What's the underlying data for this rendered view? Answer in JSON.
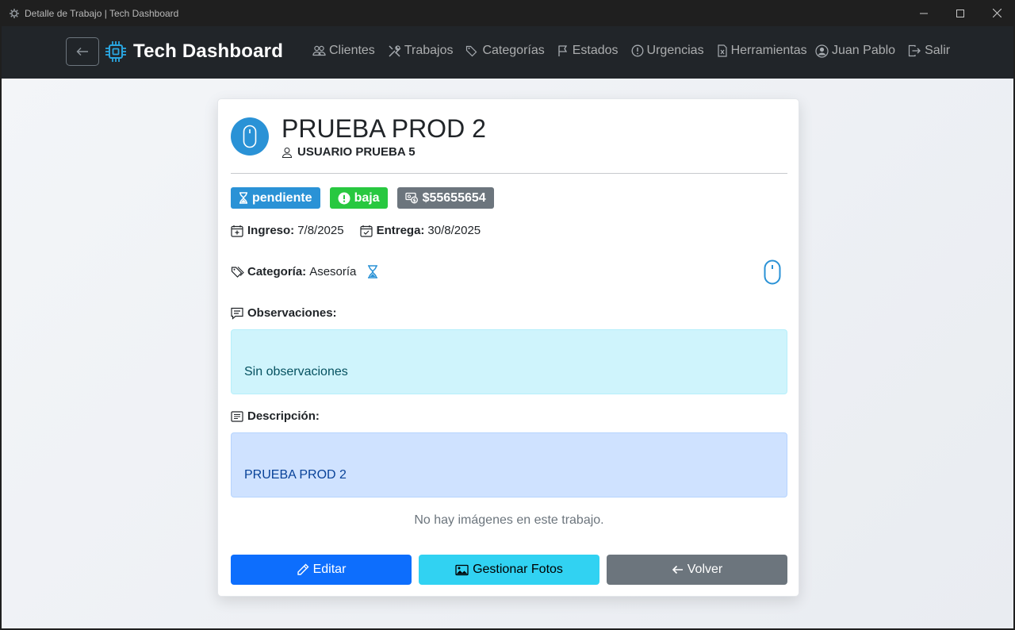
{
  "window": {
    "title": "Detalle de Trabajo | Tech Dashboard"
  },
  "navbar": {
    "brand": "Tech Dashboard",
    "links": [
      "Clientes",
      "Trabajos",
      "Categorías",
      "Estados",
      "Urgencias",
      "Herramientas"
    ],
    "user": "Juan Pablo",
    "logout": "Salir"
  },
  "job": {
    "title": "PRUEBA PROD 2",
    "client": "USUARIO PRUEBA 5",
    "status": "pendiente",
    "urgency": "baja",
    "amount": "$55655654",
    "ingreso_label": "Ingreso:",
    "ingreso": "7/8/2025",
    "entrega_label": "Entrega:",
    "entrega": "30/8/2025",
    "categoria_label": "Categoría:",
    "categoria": "Asesoría",
    "observaciones_label": "Observaciones:",
    "observaciones": "Sin observaciones",
    "descripcion_label": "Descripción:",
    "descripcion": "PRUEBA PROD 2",
    "no_images": "No hay imágenes en este trabajo."
  },
  "actions": {
    "edit": "Editar",
    "photos": "Gestionar Fotos",
    "back": "Volver"
  },
  "colors": {
    "status": "#2a92d6",
    "urgency": "#28c840",
    "amount": "#6c757d",
    "brand_icon": "#2aa6e0"
  }
}
